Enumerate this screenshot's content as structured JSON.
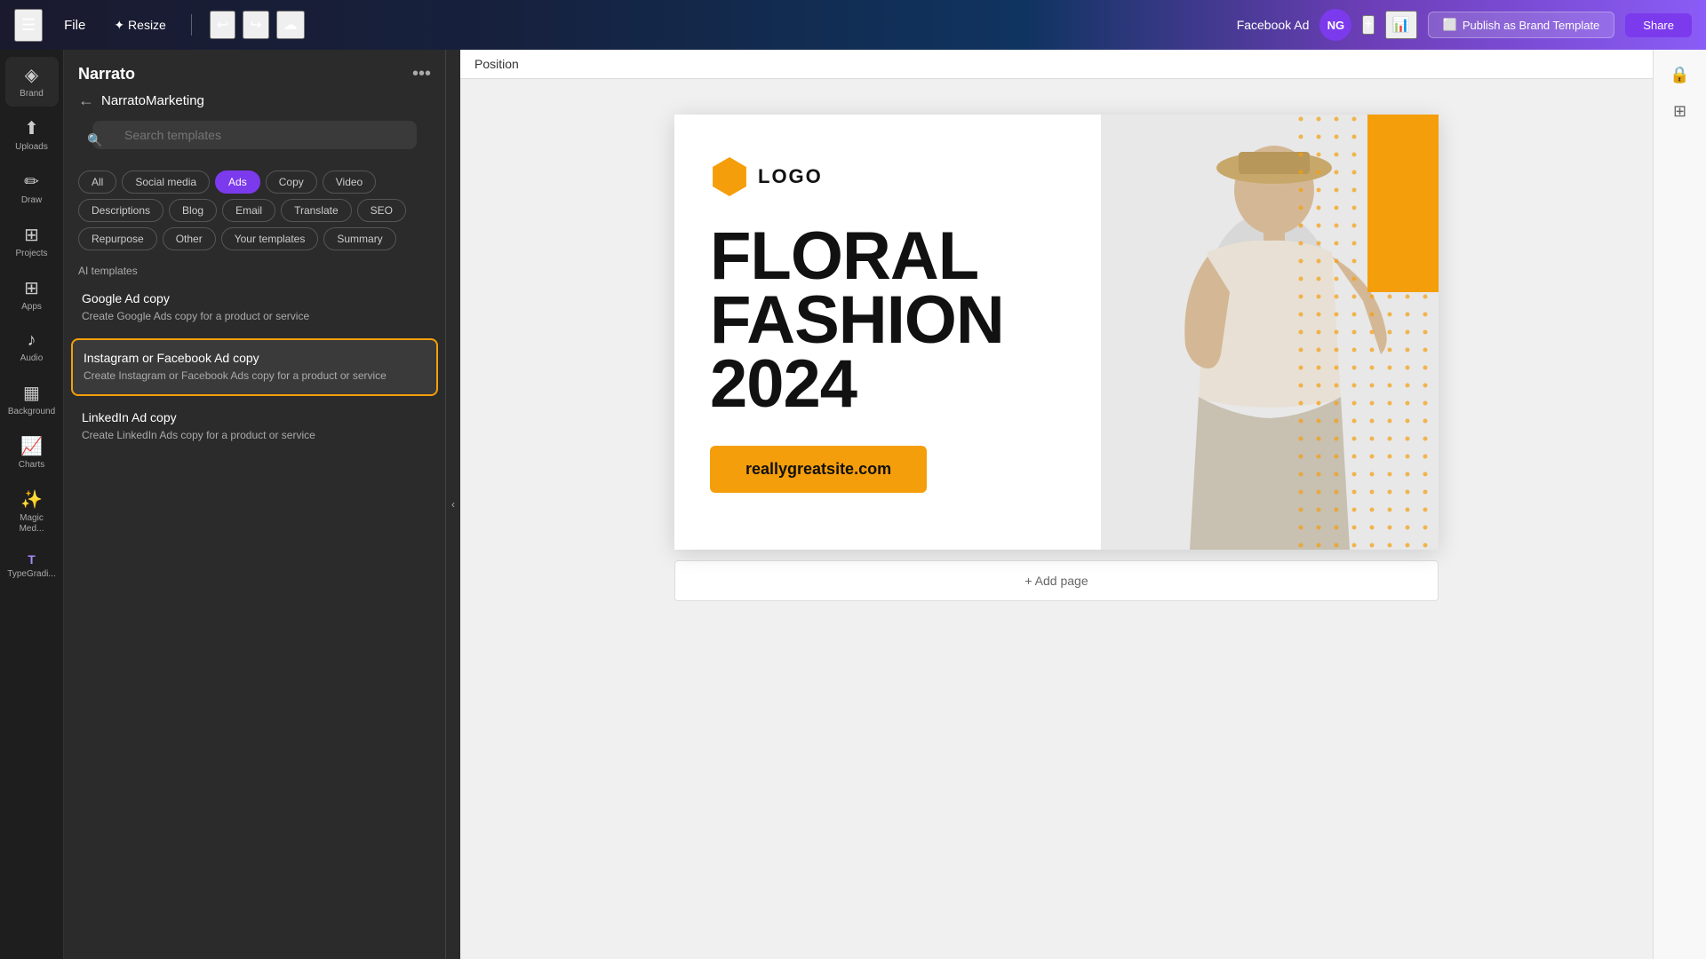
{
  "topbar": {
    "menu_icon": "☰",
    "file_label": "File",
    "resize_label": "Resize",
    "undo_icon": "↩",
    "redo_icon": "↪",
    "cloud_icon": "☁",
    "fb_ad_label": "Facebook Ad",
    "avatar_initials": "NG",
    "plus_icon": "+",
    "stats_icon": "📊",
    "publish_icon": "⬜",
    "publish_label": "Publish as Brand Template",
    "share_label": "Share"
  },
  "icon_sidebar": {
    "items": [
      {
        "id": "brand",
        "icon": "◈",
        "label": "Brand"
      },
      {
        "id": "uploads",
        "icon": "⬆",
        "label": "Uploads"
      },
      {
        "id": "draw",
        "icon": "✏",
        "label": "Draw"
      },
      {
        "id": "projects",
        "icon": "⊞",
        "label": "Projects"
      },
      {
        "id": "apps",
        "icon": "⊞",
        "label": "Apps"
      },
      {
        "id": "audio",
        "icon": "♪",
        "label": "Audio"
      },
      {
        "id": "background",
        "icon": "▦",
        "label": "Background"
      },
      {
        "id": "charts",
        "icon": "📈",
        "label": "Charts"
      },
      {
        "id": "magic-med",
        "icon": "✨",
        "label": "Magic Med..."
      },
      {
        "id": "typegrad",
        "icon": "T",
        "label": "TypeGradi..."
      }
    ]
  },
  "panel": {
    "title": "Narrato",
    "more_icon": "•••",
    "back_label": "NarratoMarketing",
    "search_placeholder": "Search templates",
    "filter_tags": [
      {
        "id": "all",
        "label": "All",
        "active": false
      },
      {
        "id": "social",
        "label": "Social media",
        "active": false
      },
      {
        "id": "ads",
        "label": "Ads",
        "active": true
      },
      {
        "id": "copy",
        "label": "Copy",
        "active": false
      },
      {
        "id": "video",
        "label": "Video",
        "active": false
      },
      {
        "id": "descriptions",
        "label": "Descriptions",
        "active": false
      },
      {
        "id": "blog",
        "label": "Blog",
        "active": false
      },
      {
        "id": "email",
        "label": "Email",
        "active": false
      },
      {
        "id": "translate",
        "label": "Translate",
        "active": false
      },
      {
        "id": "seo",
        "label": "SEO",
        "active": false
      },
      {
        "id": "repurpose",
        "label": "Repurpose",
        "active": false
      },
      {
        "id": "other",
        "label": "Other",
        "active": false
      },
      {
        "id": "your-templates",
        "label": "Your templates",
        "active": false
      },
      {
        "id": "summary",
        "label": "Summary",
        "active": false
      }
    ],
    "section_label": "AI templates",
    "templates": [
      {
        "id": "google-ad-copy",
        "title": "Google Ad copy",
        "desc": "Create Google Ads copy for a product or service",
        "selected": false
      },
      {
        "id": "instagram-facebook-ad",
        "title": "Instagram or Facebook Ad copy",
        "desc": "Create Instagram or Facebook Ads copy for a product or service",
        "selected": true
      },
      {
        "id": "linkedin-ad-copy",
        "title": "LinkedIn Ad copy",
        "desc": "Create LinkedIn Ads copy for a product or service",
        "selected": false
      }
    ]
  },
  "canvas": {
    "toolbar_label": "Position",
    "logo_text": "LOGO",
    "headline_line1": "FLORAL",
    "headline_line2": "FASHION",
    "headline_line3": "2024",
    "cta_text": "reallygreatsite.com",
    "add_page_label": "+ Add page"
  },
  "right_panel": {
    "lock_icon": "🔒",
    "layers_icon": "⊞"
  }
}
